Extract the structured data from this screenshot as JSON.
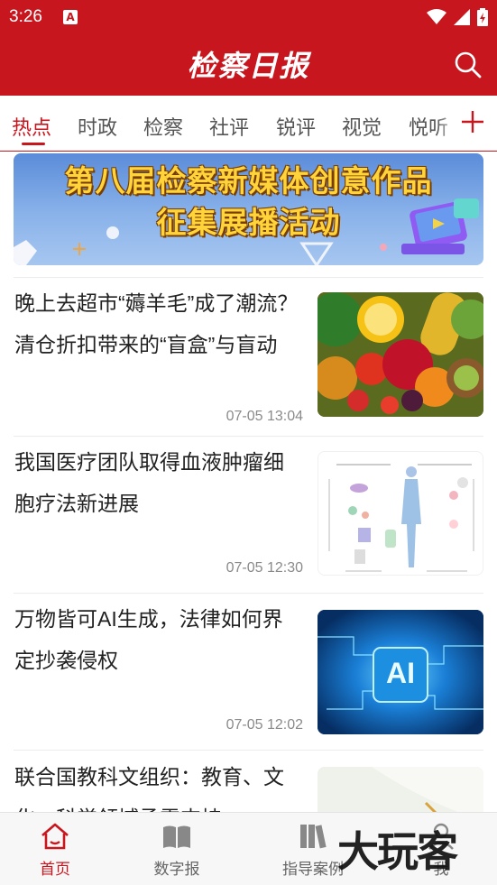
{
  "status_bar": {
    "time": "3:26",
    "notification_glyph": "A"
  },
  "header": {
    "title": "检察日报",
    "search_icon": "search-icon",
    "brand_color": "#c8161e"
  },
  "tabs": [
    {
      "label": "热点",
      "active": true
    },
    {
      "label": "时政"
    },
    {
      "label": "检察"
    },
    {
      "label": "社评"
    },
    {
      "label": "锐评"
    },
    {
      "label": "视觉"
    },
    {
      "label": "悦听"
    }
  ],
  "banner": {
    "line1": "第八届检察新媒体创意作品",
    "line2": "征集展播活动"
  },
  "news": [
    {
      "title": "晚上去超市“薅羊毛”成了潮流？清仓折扣带来的“盲盒”与盲动",
      "time": "07-05 13:04",
      "image": "fruits-vegetables"
    },
    {
      "title": "我国医疗团队取得血液肿瘤细胞疗法新进展",
      "time": "07-05 12:30",
      "image": "car-t-diagram"
    },
    {
      "title": "万物皆可AI生成，法律如何界定抄袭侵权",
      "time": "07-05 12:02",
      "image": "ai-circuit",
      "thumb_text": "AI"
    },
    {
      "title": "联合国教科文组织：教育、文化、科学领域亟需支持",
      "image": "paper-pen"
    }
  ],
  "bottom_nav": [
    {
      "label": "首页",
      "icon": "home-icon",
      "active": true
    },
    {
      "label": "数字报",
      "icon": "book-icon"
    },
    {
      "label": "指导案例",
      "icon": "books-icon"
    },
    {
      "label": "我",
      "icon": "user-icon"
    }
  ],
  "watermark": "大玩客"
}
